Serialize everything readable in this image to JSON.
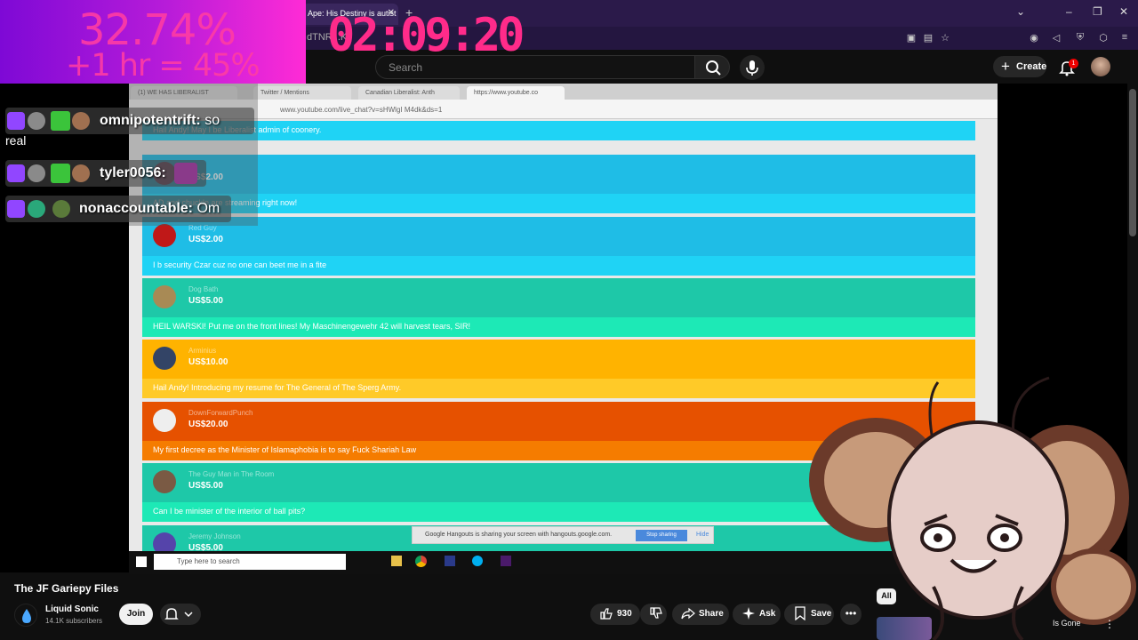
{
  "browser": {
    "tab_title": "Ape: His Destiny is autist",
    "url_fragment": "dTNR...K",
    "new_tab": "+"
  },
  "overlay": {
    "percent": "32.74%",
    "projection": "+1 hr = 45%",
    "timer": "02:09:20"
  },
  "youtube_header": {
    "search_placeholder": "Search",
    "create_label": "Create",
    "notification_count": "1"
  },
  "inner_browser": {
    "tabs": [
      "(1) WE HAS LIBERALIST",
      "Twitter / Mentions",
      "Canadian Liberalist: Anth",
      "https://www.youtube.co"
    ],
    "url": "www.youtube.com/live_chat?v=sHWlgI M4dk&ds=1",
    "taskbar_search": "Type here to search",
    "hangouts_notice": "Google Hangouts is sharing your screen with hangouts.google.com.",
    "stop_sharing": "Stop sharing",
    "hide": "Hide",
    "donations": [
      {
        "name": "",
        "amount": "",
        "message": "Hail Andy! May I be Liberalist admin of coonery.",
        "color_top": "#1fbde6",
        "color_bottom": "#1fd3f5",
        "avatar": "#888888"
      },
      {
        "name": "",
        "amount": "US$2.00",
        "message": "AD and chuckle are streaming right now!",
        "color_top": "#1fbde6",
        "color_bottom": "#1fd3f5",
        "avatar": "#774466"
      },
      {
        "name": "Red Guy",
        "amount": "US$2.00",
        "message": "I b security Czar cuz no one can beet me in a fite",
        "color_top": "#1fbde6",
        "color_bottom": "#1fd3f5",
        "avatar": "#c01818"
      },
      {
        "name": "Dog Bath",
        "amount": "US$5.00",
        "message": "HEIL WARSKI! Put me on the front lines! My Maschinengewehr 42 will harvest tears, SIR!",
        "color_top": "#1ec8a8",
        "color_bottom": "#1de9b6",
        "avatar": "#a88a55"
      },
      {
        "name": "Arminius",
        "amount": "US$10.00",
        "message": "Hail Andy! Introducing my resume for The General of The Sperg Army.",
        "color_top": "#ffb300",
        "color_bottom": "#ffca28",
        "avatar": "#334466"
      },
      {
        "name": "DownForwardPunch",
        "amount": "US$20.00",
        "message": "My first decree as the Minister of Islamaphobia is to say Fuck Shariah Law",
        "color_top": "#e65100",
        "color_bottom": "#f57c00",
        "avatar": "#eeeeee"
      },
      {
        "name": "The Guy Man in The Room",
        "amount": "US$5.00",
        "message": "Can I be minister of the interior of ball pits?",
        "color_top": "#1ec8a8",
        "color_bottom": "#1de9b6",
        "avatar": "#7a5a44"
      },
      {
        "name": "Jeremy Johnson",
        "amount": "US$5.00",
        "message": "",
        "color_top": "#1ec8a8",
        "color_bottom": "#1de9b6",
        "avatar": "#5544aa"
      }
    ]
  },
  "chat": [
    {
      "user": "omnipotentrift:",
      "message": "so",
      "wrap": "real"
    },
    {
      "user": "tyler0056:",
      "message": "",
      "wrap": ""
    },
    {
      "user": "nonaccountable:",
      "message": "Om",
      "wrap": ""
    }
  ],
  "video_info": {
    "title": "The JF Gariepy Files",
    "channel": "Liquid Sonic",
    "subscribers": "14.1K subscribers",
    "join": "Join",
    "likes": "930",
    "share": "Share",
    "ask": "Ask",
    "save": "Save"
  },
  "sidebar": {
    "chip_all": "All",
    "suggestion_title_fragment": "Is Gone"
  },
  "colors": {
    "youtube_bg": "#0f0f0f",
    "overlay_pink": "#ff2b8a",
    "twitch_purple": "#9146ff"
  }
}
